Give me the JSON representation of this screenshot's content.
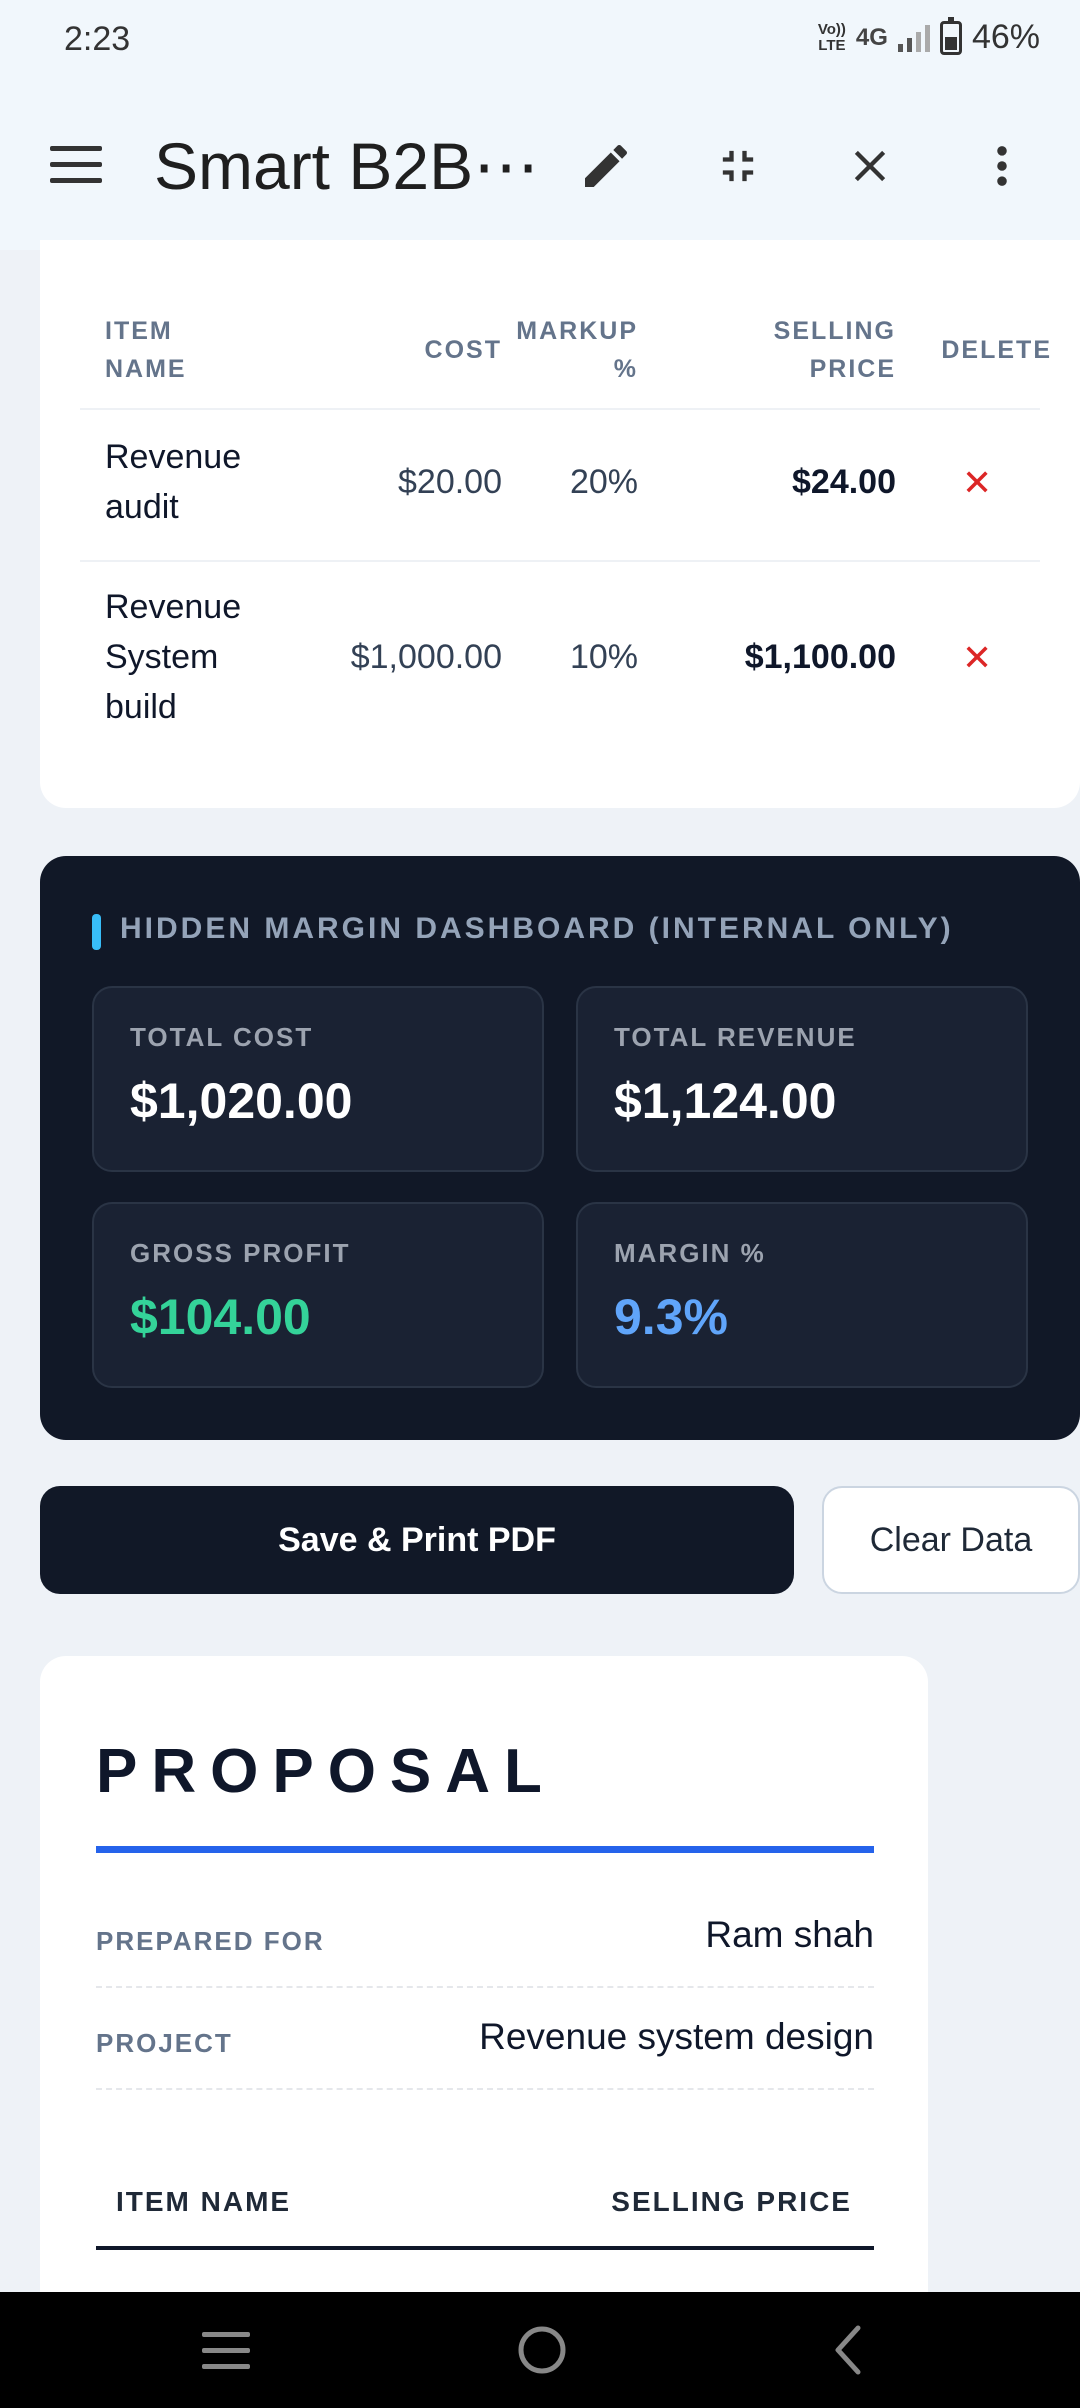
{
  "status": {
    "time": "2:23",
    "volte_top": "Vo))",
    "volte_bottom": "LTE",
    "network": "4G",
    "battery": "46%",
    "battery_level": 0.46
  },
  "appbar": {
    "title": "Smart B2B⋯"
  },
  "items_table": {
    "headers": {
      "name_1": "ITEM",
      "name_2": "NAME",
      "cost": "COST",
      "markup_1": "MARKUP",
      "markup_2": "%",
      "selling_1": "SELLING",
      "selling_2": "PRICE",
      "delete": "DELETE"
    },
    "rows": [
      {
        "name_lines": [
          "Revenue",
          "audit"
        ],
        "cost": "$20.00",
        "markup": "20%",
        "selling": "$24.00"
      },
      {
        "name_lines": [
          "Revenue",
          "System",
          "build"
        ],
        "cost": "$1,000.00",
        "markup": "10%",
        "selling": "$1,100.00"
      }
    ],
    "delete_glyph": "✕"
  },
  "dashboard": {
    "heading": "HIDDEN MARGIN DASHBOARD (INTERNAL ONLY)",
    "accent": "#38bdf8",
    "metrics": [
      {
        "label": "TOTAL COST",
        "value": "$1,020.00",
        "color": "#ffffff"
      },
      {
        "label": "TOTAL REVENUE",
        "value": "$1,124.00",
        "color": "#ffffff"
      },
      {
        "label": "GROSS PROFIT",
        "value": "$104.00",
        "color": "#34d399"
      },
      {
        "label": "MARGIN %",
        "value": "9.3%",
        "color": "#60a5fa"
      }
    ]
  },
  "actions": {
    "save_label": "Save & Print PDF",
    "clear_label": "Clear Data"
  },
  "proposal": {
    "title": "PROPOSAL",
    "prepared_for_label": "PREPARED FOR",
    "prepared_for_value": "Ram shah",
    "project_label": "PROJECT",
    "project_value": "Revenue system design",
    "table_headers": {
      "name": "ITEM NAME",
      "price": "SELLING PRICE"
    },
    "accent": "#2563eb"
  }
}
